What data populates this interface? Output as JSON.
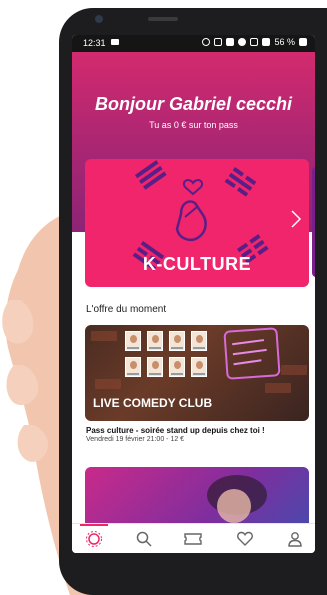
{
  "status_bar": {
    "time": "12:31",
    "battery_text": "56 %"
  },
  "header": {
    "greeting": "Bonjour Gabriel cecchi",
    "balance_text": "Tu as 0 € sur ton pass"
  },
  "banner": {
    "title": "K-CULTURE"
  },
  "offers_section": {
    "title": "L'offre du moment",
    "card_title": "LIVE COMEDY CLUB",
    "neon_text": "LIVE\nCOMEDY\nCLUB",
    "offer_name": "Pass culture - soirée stand up depuis chez toi !",
    "offer_date": "Vendredi 19 février 21:00 - 12 €"
  },
  "tabbar": {
    "items": [
      {
        "icon": "home-icon"
      },
      {
        "icon": "search-icon"
      },
      {
        "icon": "ticket-icon"
      },
      {
        "icon": "heart-icon"
      },
      {
        "icon": "profile-icon"
      }
    ]
  },
  "colors": {
    "accent": "#f0256b",
    "header_top": "#d32a6e",
    "header_bottom": "#8d2475"
  }
}
